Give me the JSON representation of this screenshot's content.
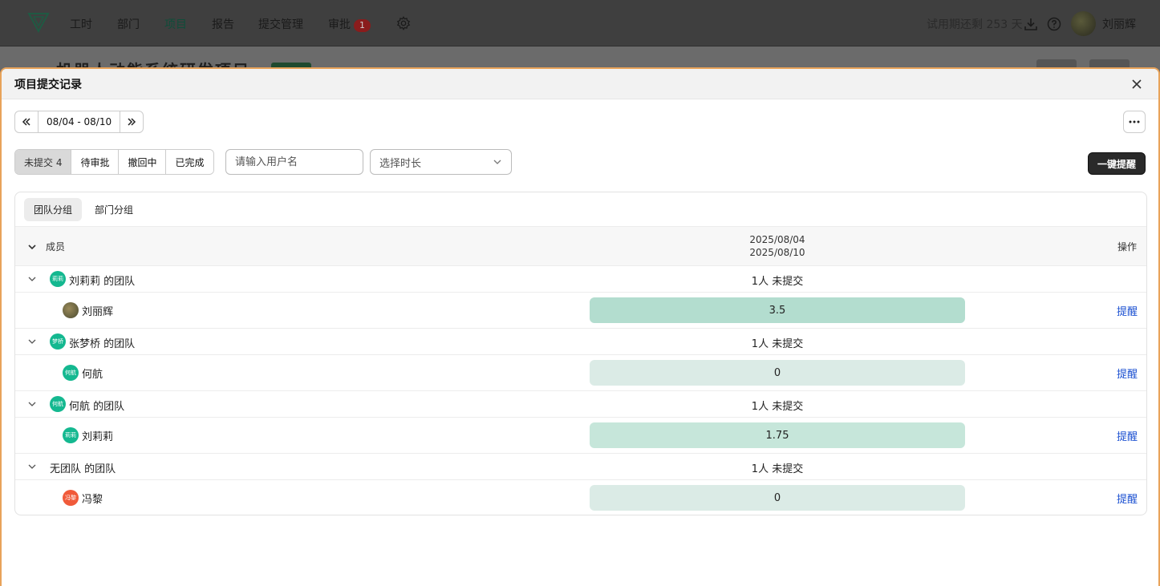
{
  "topnav": {
    "items": [
      {
        "label": "工时"
      },
      {
        "label": "部门"
      },
      {
        "label": "项目"
      },
      {
        "label": "报告"
      },
      {
        "label": "提交管理"
      },
      {
        "label": "审批"
      }
    ],
    "approval_badge": "1",
    "trial_text": "试用期还剩 253 天",
    "user_name": "刘丽辉",
    "active_item": "项目"
  },
  "background_page": {
    "title": "机器人动能系统研发项目 - A型"
  },
  "modal": {
    "title": "项目提交记录",
    "date_range": "08/04 - 08/10",
    "status_tabs": [
      {
        "label": "未提交 4",
        "active": true
      },
      {
        "label": "待审批",
        "active": false
      },
      {
        "label": "撤回中",
        "active": false
      },
      {
        "label": "已完成",
        "active": false
      }
    ],
    "search_placeholder": "请输入用户名",
    "duration_placeholder": "选择时长",
    "remind_all_label": "一键提醒",
    "group_tabs": [
      {
        "label": "团队分组",
        "active": true
      },
      {
        "label": "部门分组",
        "active": false
      }
    ],
    "table": {
      "col_member": "成员",
      "col_date_start": "2025/08/04",
      "col_date_end": "2025/08/10",
      "col_operation": "操作",
      "groups": [
        {
          "team_name": "刘莉莉 的团队",
          "team_avatar_text": "莉莉",
          "team_avatar_color": "#14b890",
          "summary": "1人 未提交",
          "member": {
            "name": "刘丽辉",
            "avatar_text": "",
            "avatar_color": "#6b6b4a",
            "hours": "3.5",
            "hours_bg": "#b3ddcf",
            "action": "提醒"
          }
        },
        {
          "team_name": "张梦桥 的团队",
          "team_avatar_text": "梦桥",
          "team_avatar_color": "#14b890",
          "summary": "1人 未提交",
          "member": {
            "name": "何航",
            "avatar_text": "何航",
            "avatar_color": "#14b890",
            "hours": "0",
            "hours_bg": "#dbebe6",
            "action": "提醒"
          }
        },
        {
          "team_name": "何航 的团队",
          "team_avatar_text": "何航",
          "team_avatar_color": "#14b890",
          "summary": "1人 未提交",
          "member": {
            "name": "刘莉莉",
            "avatar_text": "莉莉",
            "avatar_color": "#14b890",
            "hours": "1.75",
            "hours_bg": "#c6e6da",
            "action": "提醒"
          }
        },
        {
          "team_name": "无团队 的团队",
          "team_avatar_text": "",
          "team_avatar_color": "",
          "summary": "1人 未提交",
          "member": {
            "name": "冯黎",
            "avatar_text": "冯黎",
            "avatar_color": "#f05a3a",
            "hours": "0",
            "hours_bg": "#dbebe6",
            "action": "提醒"
          }
        }
      ]
    }
  }
}
